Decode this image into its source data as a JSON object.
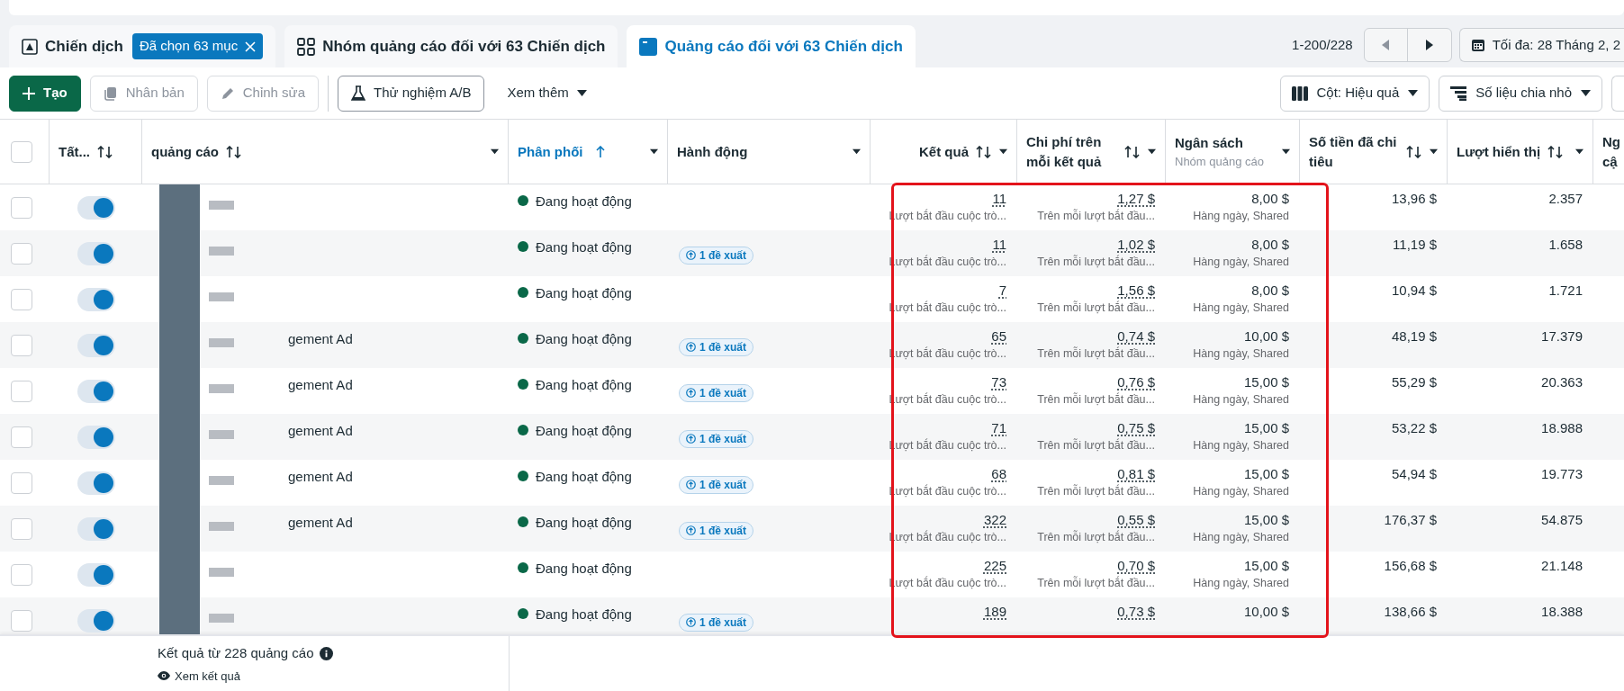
{
  "tabs": [
    {
      "kind": "campaign",
      "label": "Chiến dịch",
      "chip": "Đã chọn 63 mục",
      "selected": false
    },
    {
      "kind": "adset",
      "label": "Nhóm quảng cáo đối với 63 Chiến dịch",
      "selected": false
    },
    {
      "kind": "ad",
      "label": "Quảng cáo đối với 63 Chiến dịch",
      "selected": true
    }
  ],
  "pagination": {
    "range": "1-200/228",
    "prev_disabled": true
  },
  "date_button": {
    "label": "Tối đa: 28 Tháng 2, 2"
  },
  "toolbar": [
    {
      "kind": "create",
      "label": "Tạo",
      "disabled": false
    },
    {
      "kind": "duplicate",
      "label": "Nhân bản",
      "disabled": true
    },
    {
      "kind": "edit",
      "label": "Chỉnh sửa",
      "disabled": true
    },
    {
      "kind": "ab_test",
      "label": "Thử nghiệm A/B",
      "disabled": false
    },
    {
      "kind": "more",
      "label": "Xem thêm",
      "disabled": false
    }
  ],
  "toolbar_right": [
    {
      "kind": "columns",
      "label": "Cột: Hiệu quả"
    },
    {
      "kind": "breakdown",
      "label": "Số liệu chia nhỏ"
    }
  ],
  "table": {
    "select_all": false,
    "columns": [
      {
        "label": "Tất...",
        "sortable": true,
        "sorted": false,
        "menu": false
      },
      {
        "label": "quảng cáo",
        "sortable": true,
        "sorted": false,
        "menu": true
      },
      {
        "label": "Phân phối",
        "sortable": true,
        "sorted": true,
        "menu": true
      },
      {
        "label": "Hành động",
        "sortable": false,
        "sorted": false,
        "menu": true
      },
      {
        "label": "Kết quả",
        "sortable": true,
        "sorted": false,
        "menu": true
      },
      {
        "label": "Chi phí trên mỗi kết quả",
        "sortable": true,
        "sorted": false,
        "menu": true
      },
      {
        "label": "Ngân sách",
        "sublabel": "Nhóm quảng cáo",
        "sortable": false,
        "sorted": false,
        "menu": true
      },
      {
        "label": "Số tiền đã chi tiêu",
        "sortable": true,
        "sorted": false,
        "menu": true
      },
      {
        "label": "Lượt hiển thị",
        "sortable": true,
        "sorted": false,
        "menu": true
      },
      {
        "label": "Ng cậ"
      }
    ],
    "rows": [
      {
        "checked": false,
        "on": true,
        "status": "Đang hoạt động",
        "results": "11",
        "results_sub": "Lượt bắt đầu cuộc trò...",
        "cpr": "1,27 $",
        "cpr_sub": "Trên mỗi lượt bắt đầu...",
        "budget": "8,00 $",
        "budget_sub": "Hàng ngày, Shared",
        "spent": "13,96 $",
        "impressions": "2.357"
      },
      {
        "checked": false,
        "on": true,
        "status": "Đang hoạt động",
        "suggestion": "1 đề xuất",
        "results": "11",
        "results_sub": "Lượt bắt đầu cuộc trò...",
        "cpr": "1,02 $",
        "cpr_sub": "Trên mỗi lượt bắt đầu...",
        "budget": "8,00 $",
        "budget_sub": "Hàng ngày, Shared",
        "spent": "11,19 $",
        "impressions": "1.658"
      },
      {
        "checked": false,
        "on": true,
        "status": "Đang hoạt động",
        "results": "7",
        "results_sub": "Lượt bắt đầu cuộc trò...",
        "cpr": "1,56 $",
        "cpr_sub": "Trên mỗi lượt bắt đầu...",
        "budget": "8,00 $",
        "budget_sub": "Hàng ngày, Shared",
        "spent": "10,94 $",
        "impressions": "1.721"
      },
      {
        "checked": false,
        "on": true,
        "name": "gement Ad",
        "status": "Đang hoạt động",
        "suggestion": "1 đề xuất",
        "results": "65",
        "results_sub": "Lượt bắt đầu cuộc trò...",
        "cpr": "0,74 $",
        "cpr_sub": "Trên mỗi lượt bắt đầu...",
        "budget": "10,00 $",
        "budget_sub": "Hàng ngày, Shared",
        "spent": "48,19 $",
        "impressions": "17.379"
      },
      {
        "checked": false,
        "on": true,
        "name": "gement Ad",
        "status": "Đang hoạt động",
        "suggestion": "1 đề xuất",
        "results": "73",
        "results_sub": "Lượt bắt đầu cuộc trò...",
        "cpr": "0,76 $",
        "cpr_sub": "Trên mỗi lượt bắt đầu...",
        "budget": "15,00 $",
        "budget_sub": "Hàng ngày, Shared",
        "spent": "55,29 $",
        "impressions": "20.363"
      },
      {
        "checked": false,
        "on": true,
        "name": "gement Ad",
        "status": "Đang hoạt động",
        "suggestion": "1 đề xuất",
        "results": "71",
        "results_sub": "Lượt bắt đầu cuộc trò...",
        "cpr": "0,75 $",
        "cpr_sub": "Trên mỗi lượt bắt đầu...",
        "budget": "15,00 $",
        "budget_sub": "Hàng ngày, Shared",
        "spent": "53,22 $",
        "impressions": "18.988"
      },
      {
        "checked": false,
        "on": true,
        "name": "gement Ad",
        "status": "Đang hoạt động",
        "suggestion": "1 đề xuất",
        "results": "68",
        "results_sub": "Lượt bắt đầu cuộc trò...",
        "cpr": "0,81 $",
        "cpr_sub": "Trên mỗi lượt bắt đầu...",
        "budget": "15,00 $",
        "budget_sub": "Hàng ngày, Shared",
        "spent": "54,94 $",
        "impressions": "19.773"
      },
      {
        "checked": false,
        "on": true,
        "name": "gement Ad",
        "status": "Đang hoạt động",
        "suggestion": "1 đề xuất",
        "results": "322",
        "results_sub": "Lượt bắt đầu cuộc trò...",
        "cpr": "0,55 $",
        "cpr_sub": "Trên mỗi lượt bắt đầu...",
        "budget": "15,00 $",
        "budget_sub": "Hàng ngày, Shared",
        "spent": "176,37 $",
        "impressions": "54.875"
      },
      {
        "checked": false,
        "on": true,
        "status": "Đang hoạt động",
        "results": "225",
        "results_sub": "Lượt bắt đầu cuộc trò...",
        "cpr": "0,70 $",
        "cpr_sub": "Trên mỗi lượt bắt đầu...",
        "budget": "15,00 $",
        "budget_sub": "Hàng ngày, Shared",
        "spent": "156,68 $",
        "impressions": "21.148"
      },
      {
        "checked": false,
        "on": true,
        "status": "Đang hoạt động",
        "suggestion": "1 đề xuất",
        "results": "189",
        "cpr": "0,73 $",
        "budget": "10,00 $",
        "spent": "138,66 $",
        "impressions": "18.388"
      }
    ]
  },
  "footer": {
    "summary": "Kết quả từ 228 quảng cáo",
    "link": "Xem kết quả"
  }
}
